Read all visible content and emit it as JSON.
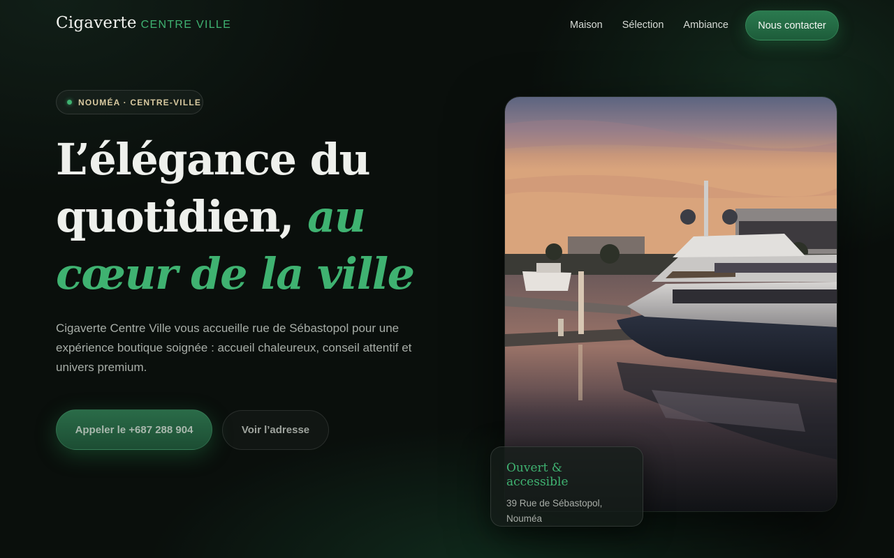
{
  "nav": {
    "brand_name": "Cigaverte",
    "brand_sub": "CENTRE VILLE",
    "links": [
      {
        "label": "Maison"
      },
      {
        "label": "Sélection"
      },
      {
        "label": "Ambiance"
      }
    ],
    "cta_label": "Nous contacter"
  },
  "hero": {
    "badge": "NOUMÉA · CENTRE-VILLE",
    "headline_plain": "L’élégance du quotidien,",
    "headline_accent": "au cœur de la ville",
    "lead": "Cigaverte Centre Ville vous accueille rue de Sébastopol pour une expérience boutique soignée : accueil chaleureux, conseil attentif et univers premium.",
    "primary_button": "Appeler le +687 288 904",
    "secondary_button": "Voir l’adresse"
  },
  "info_card": {
    "title": "Ouvert & accessible",
    "address_line1": "39 Rue de Sébastopol,",
    "address_line2": "Nouméa"
  },
  "colors": {
    "accent": "#3fb271",
    "background": "#0a0f0c",
    "badge_text": "#d8c9a0"
  }
}
